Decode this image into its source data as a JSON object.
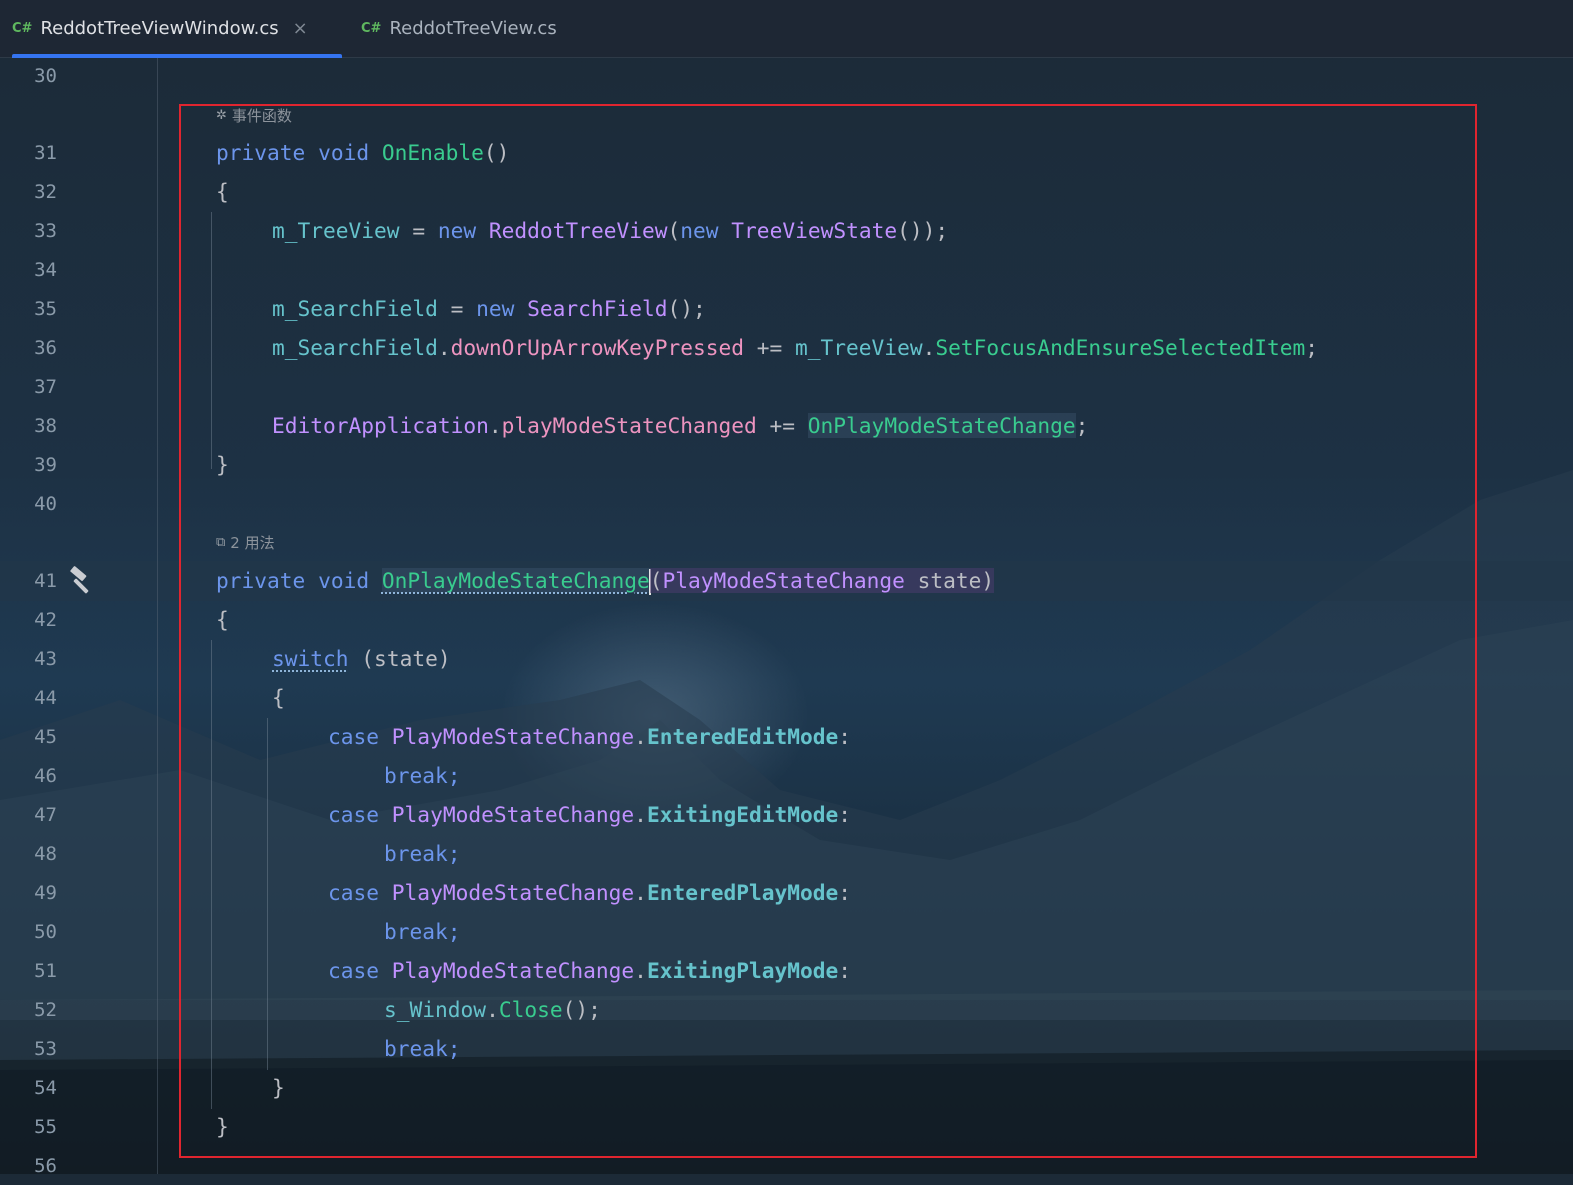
{
  "tabs": [
    {
      "lang": "C#",
      "name": "ReddotTreeViewWindow.cs",
      "active": true,
      "close": "×"
    },
    {
      "lang": "C#",
      "name": "ReddotTreeView.cs",
      "active": false
    }
  ],
  "hints": {
    "event_functions": "事件函数",
    "usages": "2 用法",
    "event_icon": "unity-icon",
    "usages_icon": "external-link-icon"
  },
  "line_numbers": [
    "30",
    "31",
    "32",
    "33",
    "34",
    "35",
    "36",
    "37",
    "38",
    "39",
    "40",
    "41",
    "42",
    "43",
    "44",
    "45",
    "46",
    "47",
    "48",
    "49",
    "50",
    "51",
    "52",
    "53",
    "54",
    "55",
    "56"
  ],
  "gutter_icon": "hammer-icon",
  "code": {
    "l31": {
      "private": "private",
      "void": "void",
      "name": "OnEnable",
      "rest": "()"
    },
    "l32": "{",
    "l33": {
      "a": "m_TreeView",
      "eq": " = ",
      "new1": "new",
      "type1": "ReddotTreeView",
      "p1": "(",
      "new2": "new",
      "type2": "TreeViewState",
      "end": "());"
    },
    "l35": {
      "a": "m_SearchField",
      "eq": " = ",
      "new": "new",
      "type": "SearchField",
      "end": "();"
    },
    "l36": {
      "a": "m_SearchField",
      "dot1": ".",
      "evt": "downOrUpArrowKeyPressed",
      "op": " += ",
      "b": "m_TreeView",
      "dot2": ".",
      "fn": "SetFocusAndEnsureSelectedItem",
      "end": ";"
    },
    "l38": {
      "type": "EditorApplication",
      "dot": ".",
      "evt": "playModeStateChanged",
      "op": " += ",
      "fn": "OnPlayModeStateChange",
      "end": ";"
    },
    "l39": "}",
    "l41": {
      "private": "private",
      "void": "void",
      "name": "OnPlayModeStateChange",
      "p1": "(",
      "type": "PlayModeStateChange",
      "param": " state",
      "p2": ")"
    },
    "l42": "{",
    "l43": {
      "kw": "switch",
      "rest": " (state)"
    },
    "l44": "{",
    "l45": {
      "case": "case",
      "type": "PlayModeStateChange",
      "dot": ".",
      "member": "EnteredEditMode",
      "colon": ":"
    },
    "l46": "break;",
    "l47": {
      "case": "case",
      "type": "PlayModeStateChange",
      "dot": ".",
      "member": "ExitingEditMode",
      "colon": ":"
    },
    "l48": "break;",
    "l49": {
      "case": "case",
      "type": "PlayModeStateChange",
      "dot": ".",
      "member": "EnteredPlayMode",
      "colon": ":"
    },
    "l50": "break;",
    "l51": {
      "case": "case",
      "type": "PlayModeStateChange",
      "dot": ".",
      "member": "ExitingPlayMode",
      "colon": ":"
    },
    "l52": {
      "a": "s_Window",
      "dot": ".",
      "fn": "Close",
      "end": "();"
    },
    "l53": "break;",
    "l54": "}",
    "l55": "}"
  },
  "colors": {
    "keyword": "#6c95eb",
    "method": "#39cc8f",
    "type": "#c191ff",
    "field": "#66c3cc",
    "event": "#ed94c0",
    "annotation_box": "#e0252f",
    "active_tab_underline": "#3574f0"
  }
}
